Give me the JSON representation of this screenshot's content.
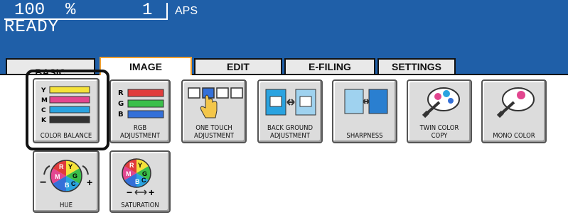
{
  "status": {
    "zoom_value": "100",
    "zoom_unit": "%",
    "copies": "1",
    "paper": "APS",
    "message": "READY"
  },
  "tabs": [
    {
      "label": "BASIC"
    },
    {
      "label": "IMAGE"
    },
    {
      "label": "EDIT"
    },
    {
      "label": "E-FILING"
    },
    {
      "label": "SETTINGS"
    }
  ],
  "functions": {
    "color_balance": {
      "label": "COLOR BALANCE",
      "rows": [
        "Y",
        "M",
        "C",
        "K"
      ]
    },
    "rgb_adjustment": {
      "label_line1": "RGB",
      "label_line2": "ADJUSTMENT",
      "rows": [
        "R",
        "G",
        "B"
      ]
    },
    "one_touch": {
      "label_line1": "ONE TOUCH",
      "label_line2": "ADJUSTMENT"
    },
    "background": {
      "label_line1": "BACK GROUND",
      "label_line2": "ADJUSTMENT"
    },
    "sharpness": {
      "label": "SHARPNESS"
    },
    "twin_color": {
      "label_line1": "TWIN COLOR",
      "label_line2": "COPY"
    },
    "mono_color": {
      "label": "MONO COLOR"
    },
    "hue": {
      "label": "HUE",
      "wheel": [
        "R",
        "Y",
        "G",
        "B",
        "C",
        "M"
      ],
      "minus": "−",
      "plus": "+"
    },
    "saturation": {
      "label": "SATURATION",
      "wheel": [
        "R",
        "Y",
        "G",
        "B",
        "C",
        "M"
      ],
      "minus": "−",
      "plus": "+"
    }
  },
  "colors": {
    "header_bg": "#1f5fa8",
    "active_tab_border": "#f0a030",
    "yellow": "#f5e23a",
    "magenta": "#e2468f",
    "cyan": "#2aa3e0",
    "black": "#333333",
    "red": "#e03c3c",
    "green": "#3bbf4a",
    "blue": "#3470d8"
  }
}
